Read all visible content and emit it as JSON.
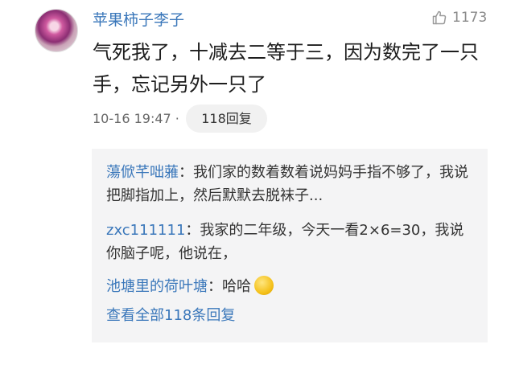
{
  "comment": {
    "username": "苹果柿子李子",
    "likes": "1173",
    "text": "气死我了，十减去二等于三，因为数完了一只手，忘记另外一只了",
    "time": "10-16 19:47 ·",
    "reply_button": "118回复"
  },
  "replies": [
    {
      "name": "蕩俽芊咄蕥",
      "sep": "：",
      "text": "我们家的数着数着说妈妈手指不够了，我说把脚指加上，然后默默去脱袜子..."
    },
    {
      "name": "zxc111111",
      "sep": "：",
      "text": "我家的二年级，今天一看2×6=30，我说你脑子呢，他说在，"
    },
    {
      "name": "池塘里的荷叶塘",
      "sep": "：",
      "text": "哈哈",
      "emoji": "grinning-face-emoji"
    }
  ],
  "view_all_replies": "查看全部118条回复",
  "icons": {
    "like": "thumbs-up-icon"
  },
  "colors": {
    "link_blue": "#3a77ba",
    "reply_bg": "#f4f4f5",
    "meta_gray": "#8a8a8a"
  }
}
